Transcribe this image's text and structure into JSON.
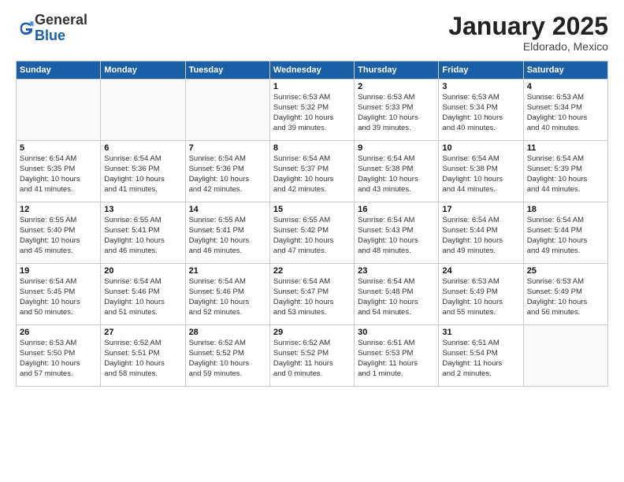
{
  "logo": {
    "line1": "General",
    "line2": "Blue"
  },
  "header": {
    "title": "January 2025",
    "subtitle": "Eldorado, Mexico"
  },
  "weekdays": [
    "Sunday",
    "Monday",
    "Tuesday",
    "Wednesday",
    "Thursday",
    "Friday",
    "Saturday"
  ],
  "weeks": [
    [
      {
        "day": "",
        "info": ""
      },
      {
        "day": "",
        "info": ""
      },
      {
        "day": "",
        "info": ""
      },
      {
        "day": "1",
        "info": "Sunrise: 6:53 AM\nSunset: 5:32 PM\nDaylight: 10 hours\nand 39 minutes."
      },
      {
        "day": "2",
        "info": "Sunrise: 6:53 AM\nSunset: 5:33 PM\nDaylight: 10 hours\nand 39 minutes."
      },
      {
        "day": "3",
        "info": "Sunrise: 6:53 AM\nSunset: 5:34 PM\nDaylight: 10 hours\nand 40 minutes."
      },
      {
        "day": "4",
        "info": "Sunrise: 6:53 AM\nSunset: 5:34 PM\nDaylight: 10 hours\nand 40 minutes."
      }
    ],
    [
      {
        "day": "5",
        "info": "Sunrise: 6:54 AM\nSunset: 5:35 PM\nDaylight: 10 hours\nand 41 minutes."
      },
      {
        "day": "6",
        "info": "Sunrise: 6:54 AM\nSunset: 5:36 PM\nDaylight: 10 hours\nand 41 minutes."
      },
      {
        "day": "7",
        "info": "Sunrise: 6:54 AM\nSunset: 5:36 PM\nDaylight: 10 hours\nand 42 minutes."
      },
      {
        "day": "8",
        "info": "Sunrise: 6:54 AM\nSunset: 5:37 PM\nDaylight: 10 hours\nand 42 minutes."
      },
      {
        "day": "9",
        "info": "Sunrise: 6:54 AM\nSunset: 5:38 PM\nDaylight: 10 hours\nand 43 minutes."
      },
      {
        "day": "10",
        "info": "Sunrise: 6:54 AM\nSunset: 5:38 PM\nDaylight: 10 hours\nand 44 minutes."
      },
      {
        "day": "11",
        "info": "Sunrise: 6:54 AM\nSunset: 5:39 PM\nDaylight: 10 hours\nand 44 minutes."
      }
    ],
    [
      {
        "day": "12",
        "info": "Sunrise: 6:55 AM\nSunset: 5:40 PM\nDaylight: 10 hours\nand 45 minutes."
      },
      {
        "day": "13",
        "info": "Sunrise: 6:55 AM\nSunset: 5:41 PM\nDaylight: 10 hours\nand 46 minutes."
      },
      {
        "day": "14",
        "info": "Sunrise: 6:55 AM\nSunset: 5:41 PM\nDaylight: 10 hours\nand 46 minutes."
      },
      {
        "day": "15",
        "info": "Sunrise: 6:55 AM\nSunset: 5:42 PM\nDaylight: 10 hours\nand 47 minutes."
      },
      {
        "day": "16",
        "info": "Sunrise: 6:54 AM\nSunset: 5:43 PM\nDaylight: 10 hours\nand 48 minutes."
      },
      {
        "day": "17",
        "info": "Sunrise: 6:54 AM\nSunset: 5:44 PM\nDaylight: 10 hours\nand 49 minutes."
      },
      {
        "day": "18",
        "info": "Sunrise: 6:54 AM\nSunset: 5:44 PM\nDaylight: 10 hours\nand 49 minutes."
      }
    ],
    [
      {
        "day": "19",
        "info": "Sunrise: 6:54 AM\nSunset: 5:45 PM\nDaylight: 10 hours\nand 50 minutes."
      },
      {
        "day": "20",
        "info": "Sunrise: 6:54 AM\nSunset: 5:46 PM\nDaylight: 10 hours\nand 51 minutes."
      },
      {
        "day": "21",
        "info": "Sunrise: 6:54 AM\nSunset: 5:46 PM\nDaylight: 10 hours\nand 52 minutes."
      },
      {
        "day": "22",
        "info": "Sunrise: 6:54 AM\nSunset: 5:47 PM\nDaylight: 10 hours\nand 53 minutes."
      },
      {
        "day": "23",
        "info": "Sunrise: 6:54 AM\nSunset: 5:48 PM\nDaylight: 10 hours\nand 54 minutes."
      },
      {
        "day": "24",
        "info": "Sunrise: 6:53 AM\nSunset: 5:49 PM\nDaylight: 10 hours\nand 55 minutes."
      },
      {
        "day": "25",
        "info": "Sunrise: 6:53 AM\nSunset: 5:49 PM\nDaylight: 10 hours\nand 56 minutes."
      }
    ],
    [
      {
        "day": "26",
        "info": "Sunrise: 6:53 AM\nSunset: 5:50 PM\nDaylight: 10 hours\nand 57 minutes."
      },
      {
        "day": "27",
        "info": "Sunrise: 6:52 AM\nSunset: 5:51 PM\nDaylight: 10 hours\nand 58 minutes."
      },
      {
        "day": "28",
        "info": "Sunrise: 6:52 AM\nSunset: 5:52 PM\nDaylight: 10 hours\nand 59 minutes."
      },
      {
        "day": "29",
        "info": "Sunrise: 6:52 AM\nSunset: 5:52 PM\nDaylight: 11 hours\nand 0 minutes."
      },
      {
        "day": "30",
        "info": "Sunrise: 6:51 AM\nSunset: 5:53 PM\nDaylight: 11 hours\nand 1 minute."
      },
      {
        "day": "31",
        "info": "Sunrise: 6:51 AM\nSunset: 5:54 PM\nDaylight: 11 hours\nand 2 minutes."
      },
      {
        "day": "",
        "info": ""
      }
    ]
  ]
}
